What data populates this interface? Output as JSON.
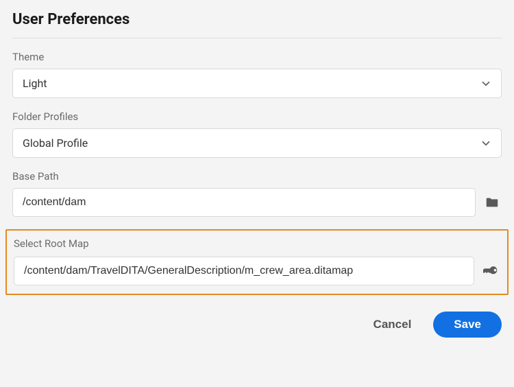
{
  "title": "User Preferences",
  "theme": {
    "label": "Theme",
    "value": "Light"
  },
  "folderProfiles": {
    "label": "Folder Profiles",
    "value": "Global Profile"
  },
  "basePath": {
    "label": "Base Path",
    "value": "/content/dam"
  },
  "rootMap": {
    "label": "Select Root Map",
    "value": "/content/dam/TravelDITA/GeneralDescription/m_crew_area.ditamap"
  },
  "buttons": {
    "cancel": "Cancel",
    "save": "Save"
  }
}
